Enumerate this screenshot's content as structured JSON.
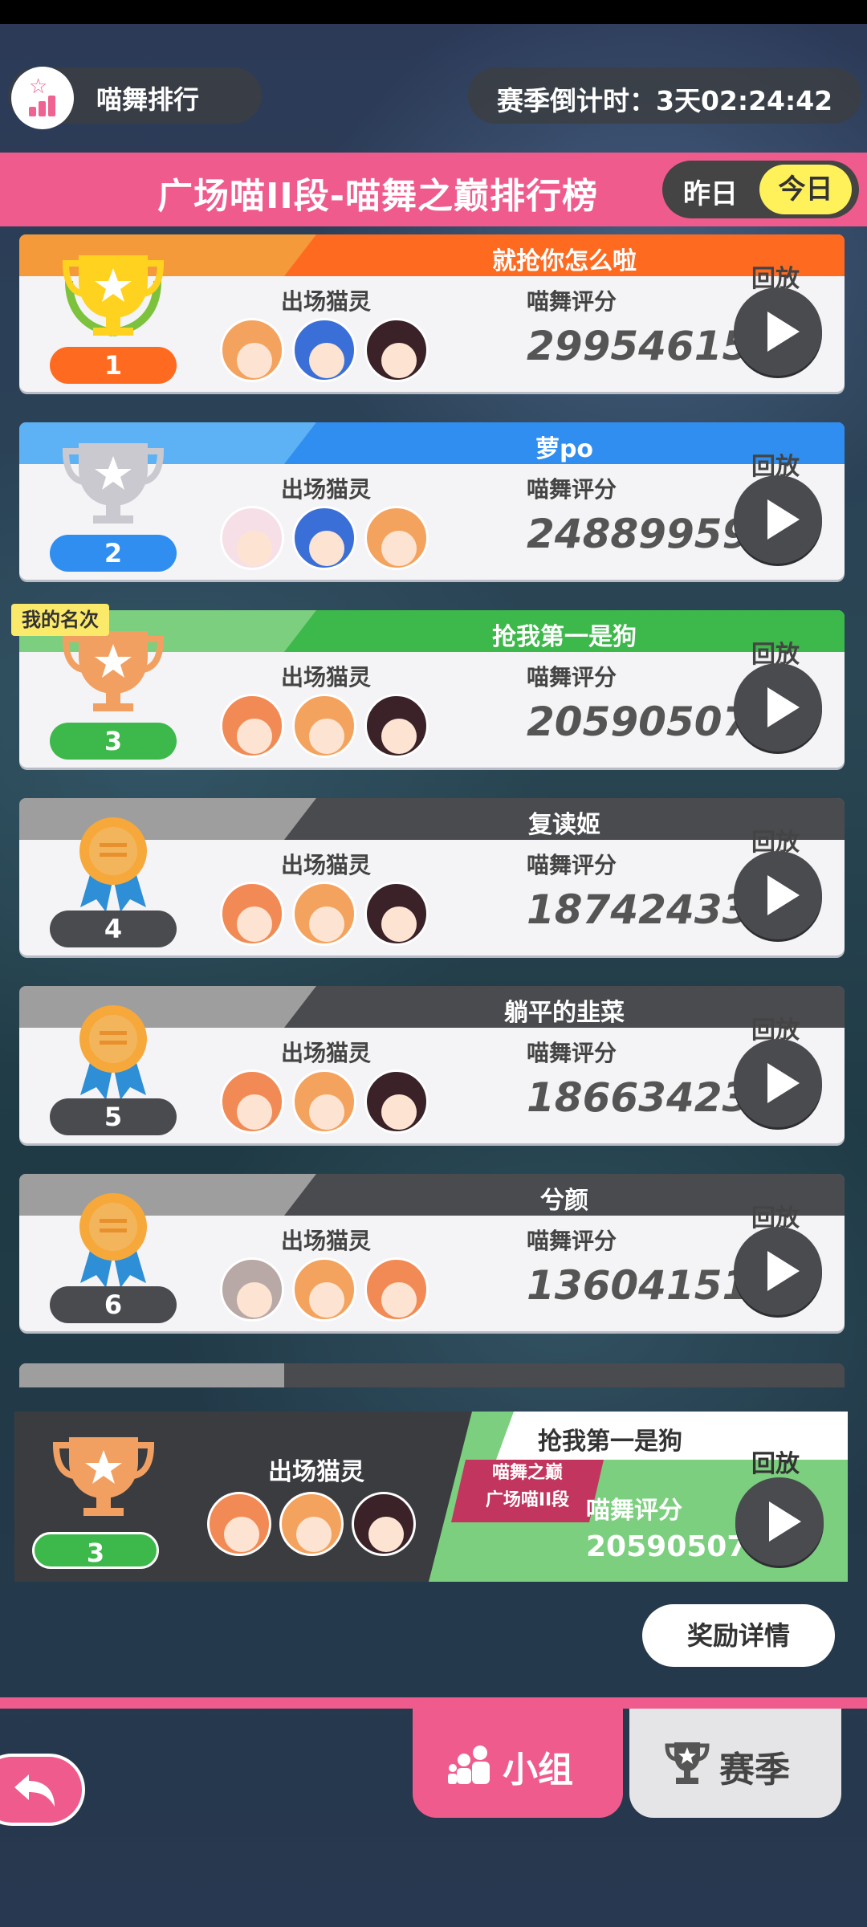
{
  "header_left": {
    "title": "喵舞排行",
    "icon": "chart-icon"
  },
  "countdown": {
    "text": "赛季倒计时：3天02:24:42"
  },
  "board": {
    "title": "广场喵II段-喵舞之巅排行榜",
    "toggle": {
      "yesterday": "昨日",
      "today": "今日",
      "selected": "today"
    }
  },
  "labels": {
    "cats": "出场猫灵",
    "score": "喵舞评分",
    "replay": "回放",
    "my_rank": "我的名次"
  },
  "entries": [
    {
      "rank": "1",
      "name": "就抢你怎么啦",
      "score": "29954615",
      "badge": "gold-cup-laurel-icon",
      "light": "#f59a3b",
      "dark": "#ff6a21",
      "pill": "#ff6a21"
    },
    {
      "rank": "2",
      "name": "萝po",
      "score": "24889959",
      "badge": "silver-cup-icon",
      "light": "#5cb2f4",
      "dark": "#2f8ef0",
      "pill": "#2f8ef0"
    },
    {
      "rank": "3",
      "name": "抢我第一是狗",
      "score": "20590507",
      "badge": "bronze-cup-icon",
      "light": "#7ccf7f",
      "dark": "#3db84a",
      "pill": "#3db84a"
    },
    {
      "rank": "4",
      "name": "复读姬",
      "score": "18742433",
      "badge": "ribbon-medal-icon",
      "light": "#9e9e9e",
      "dark": "#4a4b4f",
      "pill": "#4a4b4f"
    },
    {
      "rank": "5",
      "name": "躺平的韭菜",
      "score": "18663423",
      "badge": "ribbon-medal-icon",
      "light": "#9e9e9e",
      "dark": "#4a4b4f",
      "pill": "#4a4b4f"
    },
    {
      "rank": "6",
      "name": "兮颜",
      "score": "13604151",
      "badge": "ribbon-medal-icon",
      "light": "#9e9e9e",
      "dark": "#4a4b4f",
      "pill": "#4a4b4f"
    }
  ],
  "my_entry": {
    "rank": "3",
    "name": "抢我第一是狗",
    "tier_line1": "喵舞之巅",
    "tier_line2": "广场喵II段",
    "score": "20590507"
  },
  "reward_button": "奖励详情",
  "tabs": {
    "group": "小组",
    "season": "赛季",
    "active": "group"
  },
  "colors": {
    "accent_pink": "#ef5b8c",
    "toggle_yellow": "#fff15a"
  }
}
